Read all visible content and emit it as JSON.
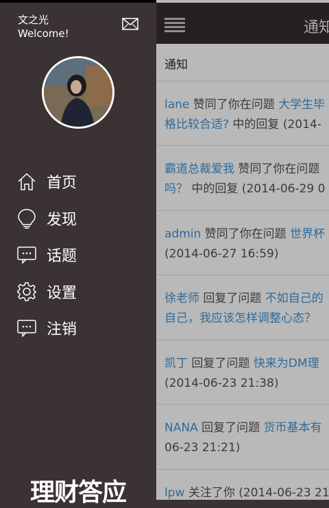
{
  "drawer": {
    "user_name": "文之光",
    "welcome": "Welcome!",
    "nav": [
      {
        "label": "首页",
        "icon": "home-icon"
      },
      {
        "label": "发现",
        "icon": "lightbulb-icon"
      },
      {
        "label": "话题",
        "icon": "chat-icon"
      },
      {
        "label": "设置",
        "icon": "gear-icon"
      },
      {
        "label": "注销",
        "icon": "chat-icon"
      }
    ],
    "logo_text": "理财答应"
  },
  "content": {
    "title": "通知",
    "section_title": "通知",
    "feed": [
      {
        "line1_user": "lane",
        "line1_text": " 赞同了你在问题 ",
        "line1_question": "大学生毕",
        "line2_question": "格比较合适?",
        "line2_text": " 中的回复 (2014-"
      },
      {
        "line1_user": "霸道总裁爱我",
        "line1_text": " 赞同了你在问题",
        "line2_question": "吗？",
        "line2_text": " 中的回复 (2014-06-29 0"
      },
      {
        "line1_user": "admin",
        "line1_text": " 赞同了你在问题 ",
        "line1_question": "世界杯",
        "line2_text": "(2014-06-27 16:59)"
      },
      {
        "line1_user": "徐老师",
        "line1_text": " 回复了问题 ",
        "line1_question": "不如自己的",
        "line2_question": "自己，我应该怎样调整心态？"
      },
      {
        "line1_user": "凯丁",
        "line1_text": " 回复了问题 ",
        "line1_question": "快来为DM理",
        "line2_text": "(2014-06-23 21:38)"
      },
      {
        "line1_user": "NANA",
        "line1_text": " 回复了问题 ",
        "line1_question": "货币基本有",
        "line2_text": "06-23 21:21)"
      },
      {
        "line1_user": "lpw",
        "line1_text": " 关注了你 (2014-06-23 21"
      }
    ]
  },
  "colors": {
    "drawer_bg": "#3a3233",
    "topbar_bg": "#262022",
    "link": "#2f6a99"
  }
}
